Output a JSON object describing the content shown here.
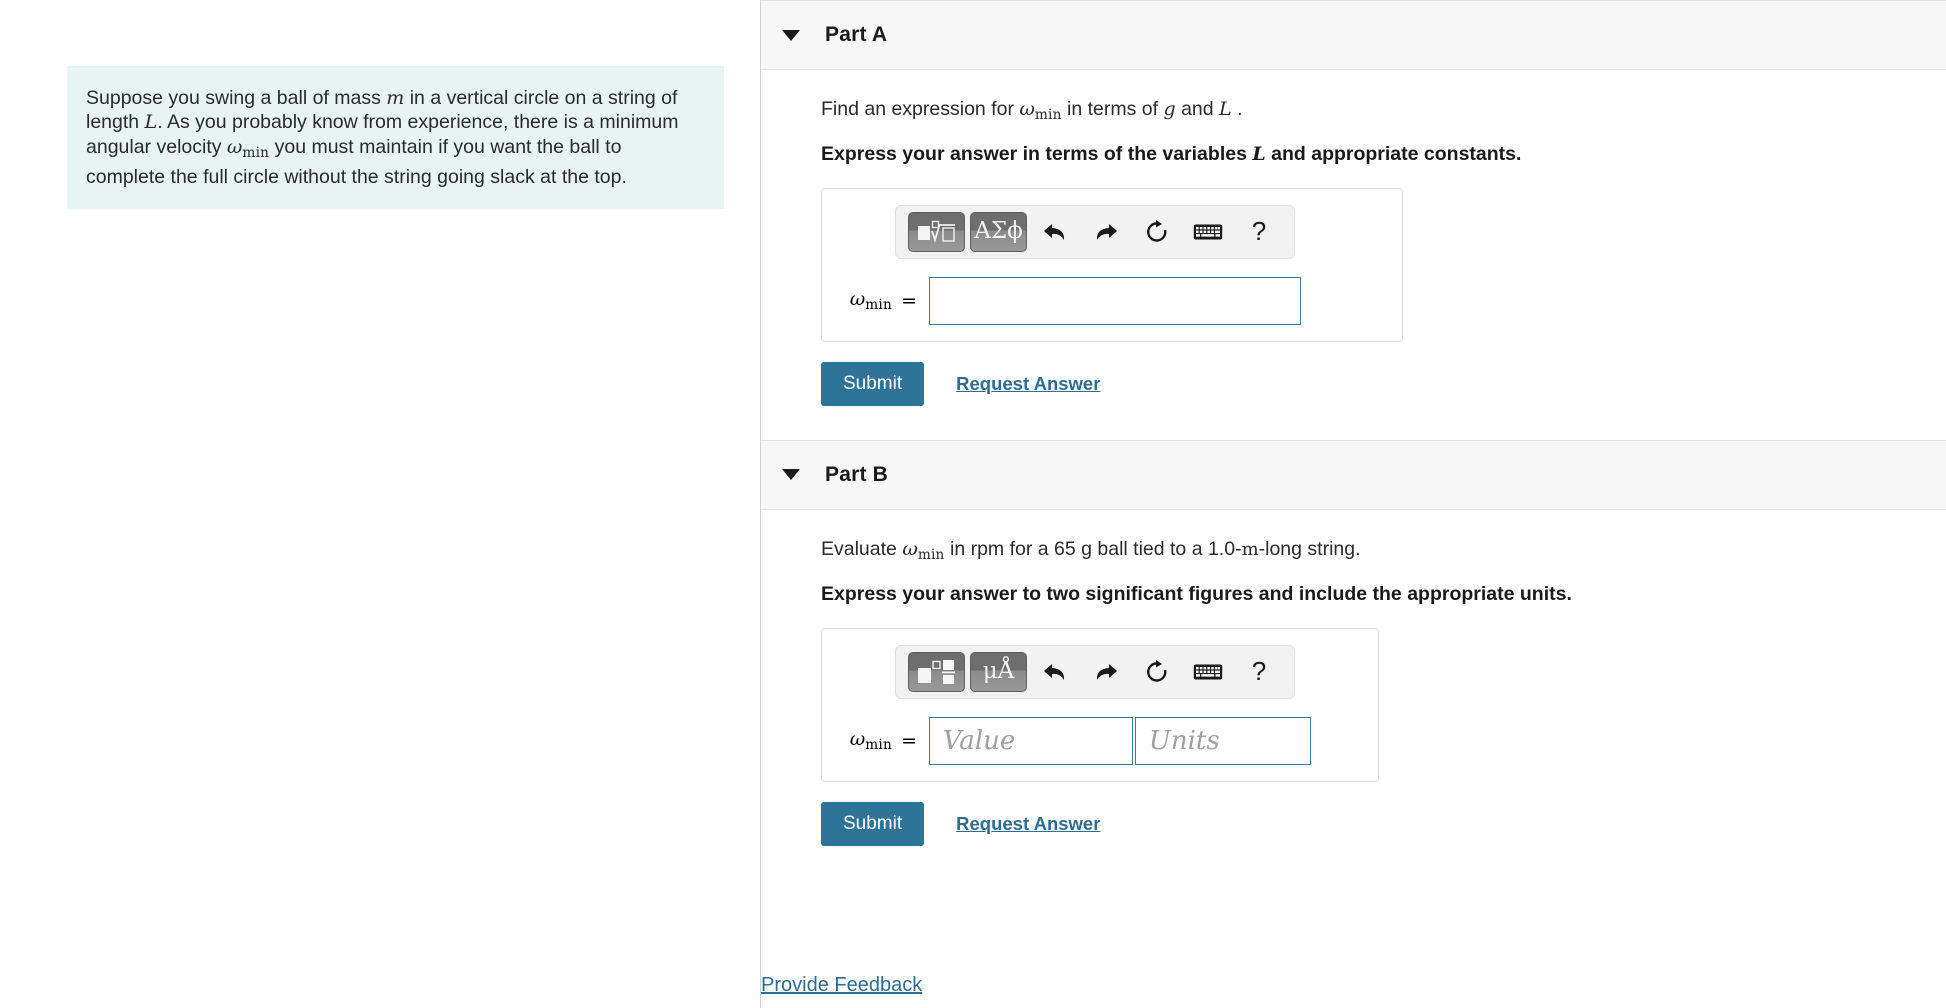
{
  "problem": {
    "text_parts": [
      "Suppose you swing a ball of mass ",
      "m",
      " in a vertical circle on a string of length ",
      "L",
      ". As you probably know from experience, there is a minimum angular velocity ",
      "ωmin",
      " you must maintain if you want the ball to complete the full circle without the string going slack at the top."
    ],
    "full_text": "Suppose you swing a ball of mass m in a vertical circle on a string of length L. As you probably know from experience, there is a minimum angular velocity ωmin you must maintain if you want the ball to complete the full circle without the string going slack at the top.",
    "segments": {
      "s1": "Suppose you swing a ball of mass",
      "v1": "m",
      "s2": "in a vertical circle on a string of length",
      "v2": "L",
      "s3": ". As you probably know from experience, there is a minimum angular velocity",
      "v3": "ω",
      "v3sub": "min",
      "s4": "you must maintain if you want the ball to complete the full circle without the string going slack at the top."
    },
    "bg_color": "#e8f4f4"
  },
  "parts": {
    "a": {
      "title": "Part A",
      "caret_icon": "caret-down-icon",
      "question": {
        "s1": "Find an expression for",
        "v1": "ω",
        "v1sub": "min",
        "s2": "in terms of",
        "v2": "g",
        "s3": "and",
        "v3": "L",
        "s4": "."
      },
      "instruction": {
        "s1": "Express your answer in terms of the variables",
        "v1": "L",
        "s2": "and appropriate constants."
      },
      "toolbar": {
        "buttons": [
          {
            "name": "template-sqrt-button",
            "label": "√"
          },
          {
            "name": "greek-symbols-button",
            "label": "ΑΣϕ"
          },
          {
            "name": "undo-button",
            "label": "undo-icon"
          },
          {
            "name": "redo-button",
            "label": "redo-icon"
          },
          {
            "name": "reset-button",
            "label": "refresh-icon"
          },
          {
            "name": "keyboard-button",
            "label": "keyboard-icon"
          },
          {
            "name": "help-button",
            "label": "?"
          }
        ],
        "greek_label": "ΑΣϕ",
        "help_label": "?"
      },
      "field": {
        "var": "ω",
        "var_sub": "min",
        "equals": "=",
        "value": "",
        "placeholder": ""
      },
      "submit_label": "Submit",
      "request_answer_label": "Request Answer"
    },
    "b": {
      "title": "Part B",
      "caret_icon": "caret-down-icon",
      "question": {
        "s1": "Evaluate",
        "v1": "ω",
        "v1sub": "min",
        "s2": "in rpm for a 65 g ball tied to a 1.0-",
        "v2": "m",
        "s3": "-long string."
      },
      "instruction": {
        "s1": "Express your answer to two significant figures and include the appropriate units."
      },
      "toolbar": {
        "buttons": [
          {
            "name": "template-fraction-button",
            "label": "□"
          },
          {
            "name": "units-symbols-button",
            "label": "μÅ"
          },
          {
            "name": "undo-button",
            "label": "undo-icon"
          },
          {
            "name": "redo-button",
            "label": "redo-icon"
          },
          {
            "name": "reset-button",
            "label": "refresh-icon"
          },
          {
            "name": "keyboard-button",
            "label": "keyboard-icon"
          },
          {
            "name": "help-button",
            "label": "?"
          }
        ],
        "units_label": "μÅ",
        "help_label": "?"
      },
      "field": {
        "var": "ω",
        "var_sub": "min",
        "equals": "=",
        "value_placeholder": "Value",
        "units_placeholder": "Units"
      },
      "submit_label": "Submit",
      "request_answer_label": "Request Answer"
    }
  },
  "footer": {
    "feedback_label": "Provide Feedback"
  },
  "colors": {
    "submit_bg": "#2e7498",
    "link": "#2e6d93",
    "problem_bg": "#e8f4f4",
    "header_bg": "#f7f7f7",
    "field_border": "#3d7c9a"
  }
}
